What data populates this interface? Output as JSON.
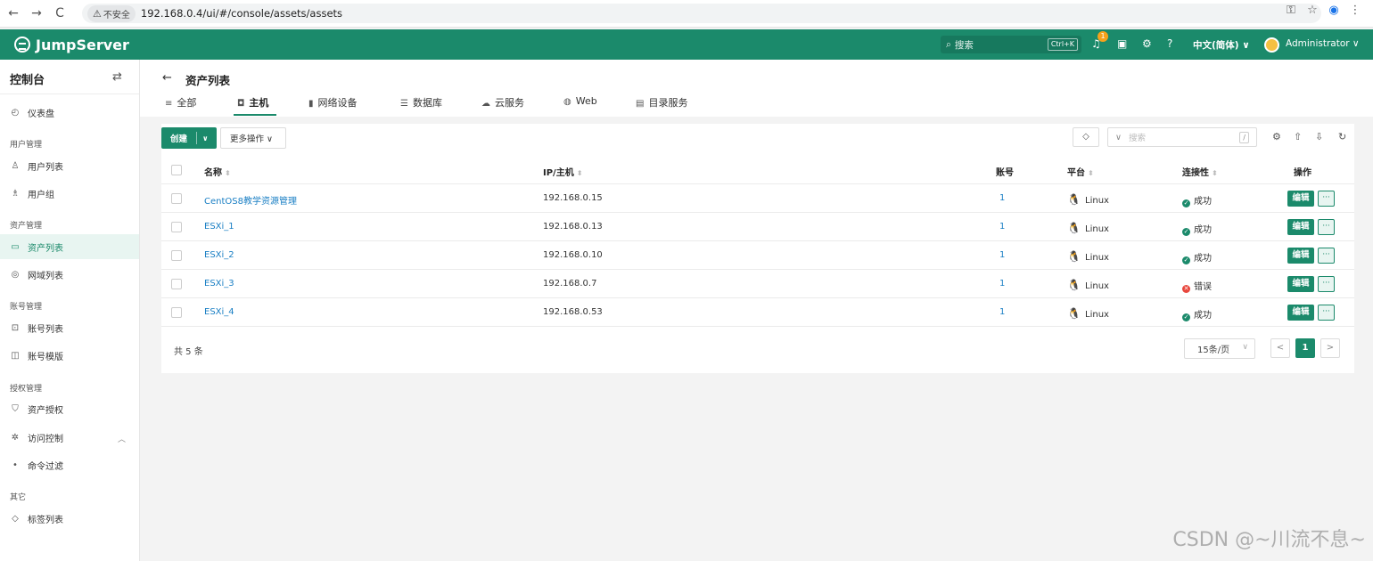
{
  "browser": {
    "back": "←",
    "forward": "→",
    "reload": "C",
    "security_label": "不安全",
    "url": "192.168.0.4/ui/#/console/assets/assets"
  },
  "header": {
    "brand": "JumpServer",
    "search_placeholder": "搜索",
    "shortcut": "Ctrl+K",
    "notification_count": "1",
    "language": "中文(简体) ∨",
    "user": "Administrator ∨"
  },
  "sidebar": {
    "title": "控制台",
    "items": [
      {
        "label": "仪表盘"
      },
      {
        "group": "用户管理"
      },
      {
        "label": "用户列表"
      },
      {
        "label": "用户组"
      },
      {
        "group": "资产管理"
      },
      {
        "label": "资产列表"
      },
      {
        "label": "网域列表"
      },
      {
        "group": "账号管理"
      },
      {
        "label": "账号列表"
      },
      {
        "label": "账号模版"
      },
      {
        "group": "授权管理"
      },
      {
        "label": "资产授权"
      },
      {
        "label": "访问控制"
      },
      {
        "label": "命令过滤"
      },
      {
        "group": "其它"
      },
      {
        "label": "标签列表"
      }
    ]
  },
  "page": {
    "title": "资产列表",
    "tabs": [
      {
        "label": "全部"
      },
      {
        "label": "主机"
      },
      {
        "label": "网络设备"
      },
      {
        "label": "数据库"
      },
      {
        "label": "云服务"
      },
      {
        "label": "Web"
      },
      {
        "label": "目录服务"
      }
    ],
    "active_tab": "主机"
  },
  "toolbar": {
    "create_label": "创建",
    "more_label": "更多操作 ∨",
    "search_placeholder": "搜索",
    "search_shortcut": "/"
  },
  "table": {
    "columns": [
      "名称",
      "IP/主机",
      "账号",
      "平台",
      "连接性",
      "操作"
    ],
    "rows": [
      {
        "name": "CentOS8教学资源管理",
        "ip": "192.168.0.15",
        "accounts": "1",
        "platform": "Linux",
        "status": "成功",
        "status_type": "ok"
      },
      {
        "name": "ESXi_1",
        "ip": "192.168.0.13",
        "accounts": "1",
        "platform": "Linux",
        "status": "成功",
        "status_type": "ok"
      },
      {
        "name": "ESXi_2",
        "ip": "192.168.0.10",
        "accounts": "1",
        "platform": "Linux",
        "status": "成功",
        "status_type": "ok"
      },
      {
        "name": "ESXi_3",
        "ip": "192.168.0.7",
        "accounts": "1",
        "platform": "Linux",
        "status": "错误",
        "status_type": "err"
      },
      {
        "name": "ESXi_4",
        "ip": "192.168.0.53",
        "accounts": "1",
        "platform": "Linux",
        "status": "成功",
        "status_type": "ok"
      }
    ],
    "edit_label": "编辑",
    "more_label": "···"
  },
  "pagination": {
    "total": "共 5 条",
    "page_size": "15条/页",
    "current_page": "1",
    "prev": "<",
    "next": ">"
  },
  "colors": {
    "brand": "#1b8a6b",
    "link": "#1a7fc4",
    "error": "#e8463c"
  },
  "watermark": "CSDN @~川流不息~"
}
